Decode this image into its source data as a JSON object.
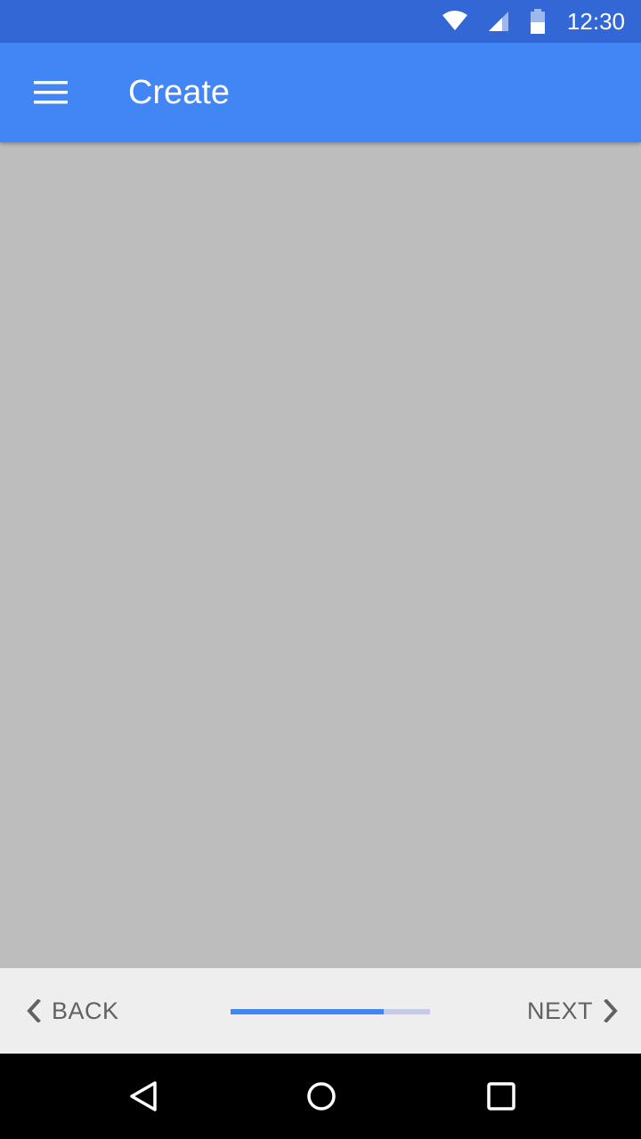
{
  "status_bar": {
    "time": "12:30",
    "icons": [
      "wifi-icon",
      "cell-signal-icon",
      "battery-icon"
    ],
    "color": "#3367d6"
  },
  "app_bar": {
    "title": "Create",
    "menu_icon": "menu-icon",
    "color": "#4285f4"
  },
  "content": {
    "background": "#bdbdbd"
  },
  "stepper": {
    "back_label": "BACK",
    "next_label": "NEXT",
    "back_icon": "chevron-left-icon",
    "next_icon": "chevron-right-icon",
    "progress": 0.77,
    "progress_color": "#4285f4",
    "track_color": "#c5cae9"
  },
  "nav_bar": {
    "icons": [
      "back-triangle-icon",
      "home-circle-icon",
      "recents-square-icon"
    ]
  }
}
